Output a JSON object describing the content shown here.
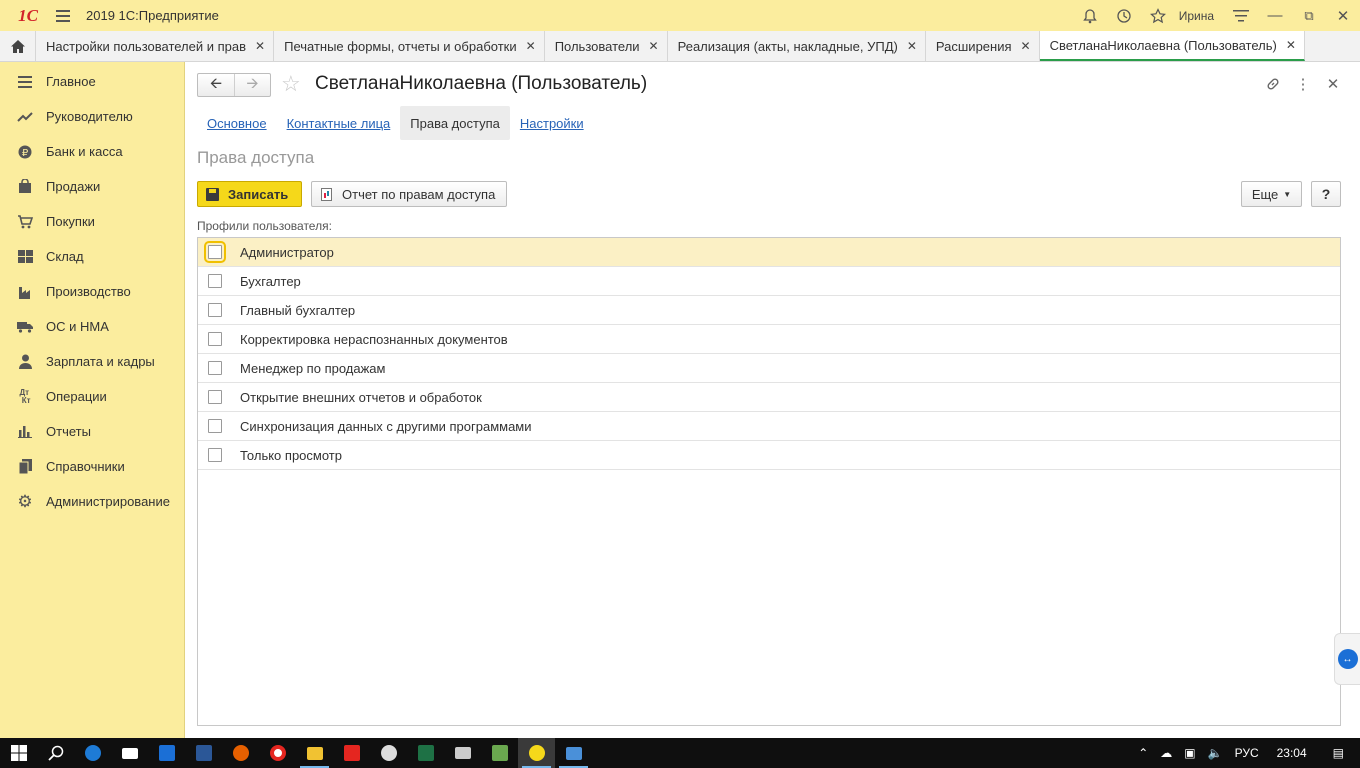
{
  "app": {
    "logo_text": "1С",
    "title": "2019 1С:Предприятие",
    "user": "Ирина"
  },
  "tabs": [
    {
      "label": "Настройки пользователей и прав"
    },
    {
      "label": "Печатные формы, отчеты и обработки"
    },
    {
      "label": "Пользователи"
    },
    {
      "label": "Реализация (акты, накладные, УПД)"
    },
    {
      "label": "Расширения"
    },
    {
      "label": "СветланаНиколаевна (Пользователь)"
    }
  ],
  "sidebar": {
    "items": [
      {
        "label": "Главное",
        "icon": "hamburger-icon"
      },
      {
        "label": "Руководителю",
        "icon": "trend-icon"
      },
      {
        "label": "Банк и касса",
        "icon": "ruble-icon"
      },
      {
        "label": "Продажи",
        "icon": "bag-icon"
      },
      {
        "label": "Покупки",
        "icon": "cart-icon"
      },
      {
        "label": "Склад",
        "icon": "grid-icon"
      },
      {
        "label": "Производство",
        "icon": "factory-icon"
      },
      {
        "label": "ОС и НМА",
        "icon": "truck-icon"
      },
      {
        "label": "Зарплата и кадры",
        "icon": "person-icon"
      },
      {
        "label": "Операции",
        "icon": "dt-kt-icon"
      },
      {
        "label": "Отчеты",
        "icon": "bar-chart-icon"
      },
      {
        "label": "Справочники",
        "icon": "book-icon"
      },
      {
        "label": "Администрирование",
        "icon": "gear-icon"
      }
    ]
  },
  "form": {
    "title": "СветланаНиколаевна (Пользователь)",
    "tabs": [
      {
        "label": "Основное"
      },
      {
        "label": "Контактные лица"
      },
      {
        "label": "Права доступа"
      },
      {
        "label": "Настройки"
      }
    ],
    "section_title": "Права доступа",
    "save_label": "Записать",
    "report_label": "Отчет по правам доступа",
    "more_label": "Еще",
    "help_label": "?",
    "profiles_label": "Профили пользователя:",
    "profiles": [
      {
        "name": "Администратор",
        "checked": false
      },
      {
        "name": "Бухгалтер",
        "checked": false
      },
      {
        "name": "Главный бухгалтер",
        "checked": false
      },
      {
        "name": "Корректировка нераспознанных документов",
        "checked": false
      },
      {
        "name": "Менеджер по продажам",
        "checked": false
      },
      {
        "name": "Открытие внешних отчетов и обработок",
        "checked": false
      },
      {
        "name": "Синхронизация данных с другими программами",
        "checked": false
      },
      {
        "name": "Только просмотр",
        "checked": false
      }
    ]
  },
  "taskbar": {
    "lang": "РУС",
    "time": "23:04"
  },
  "colors": {
    "sidebar_bg": "#fbed9e",
    "save_button": "#f5d81a",
    "link": "#2763b7",
    "selected_row": "#fbf0c5",
    "active_tab_underline": "#2a9d4a"
  }
}
